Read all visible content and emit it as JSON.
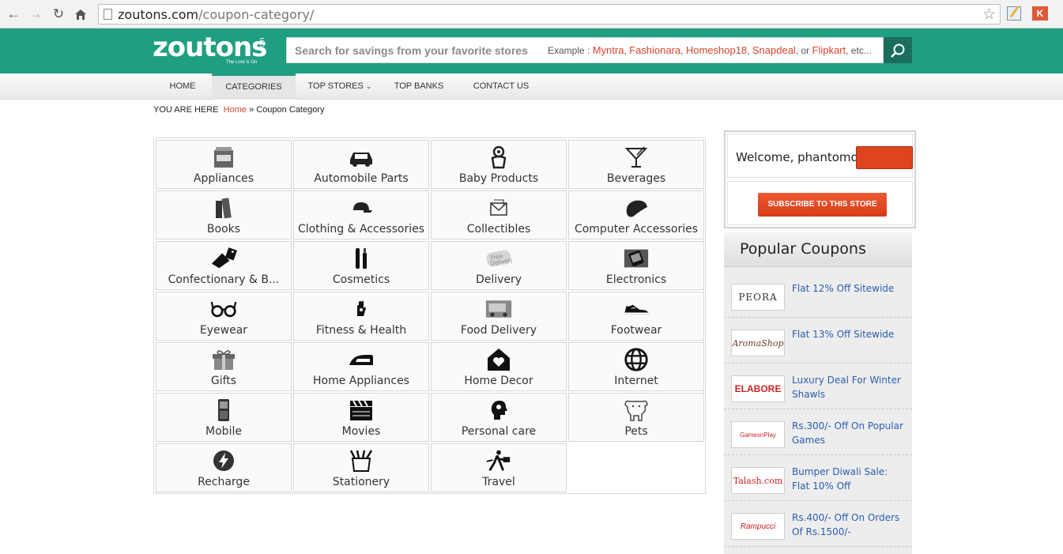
{
  "browser": {
    "url_domain": "zoutons.com",
    "url_path": "/coupon-category/",
    "ext2_label": "K"
  },
  "header": {
    "logo_word": "zoutons",
    "logo_com": ".com",
    "logo_tagline": "The Loot is On",
    "search_placeholder": "Search for savings from your favorite stores",
    "example_label": "Example :",
    "example_stores": [
      "Myntra",
      "Fashionara",
      "Homeshop18",
      "Snapdeal",
      "Flipkart"
    ],
    "example_sep": ",",
    "example_or": ", or",
    "example_etc": ", etc..."
  },
  "menu": {
    "items": [
      "HOME",
      "CATEGORIES",
      "TOP STORES",
      "TOP BANKS",
      "CONTACT US"
    ],
    "active": "CATEGORIES"
  },
  "breadcrumb": {
    "prefix": "YOU ARE HERE",
    "home": "Home",
    "sep": "»",
    "current": "Coupon Category"
  },
  "categories": [
    {
      "label": "Appliances",
      "icon": "appliance-icon"
    },
    {
      "label": "Automobile Parts",
      "icon": "car-icon"
    },
    {
      "label": "Baby Products",
      "icon": "baby-icon"
    },
    {
      "label": "Beverages",
      "icon": "cocktail-icon"
    },
    {
      "label": "Books",
      "icon": "books-icon"
    },
    {
      "label": "Clothing & Accessories",
      "icon": "cap-icon"
    },
    {
      "label": "Collectibles",
      "icon": "envelope-icon"
    },
    {
      "label": "Computer Accessories",
      "icon": "mouse-icon"
    },
    {
      "label": "Confectionary & B...",
      "icon": "candy-icon"
    },
    {
      "label": "Cosmetics",
      "icon": "cosmetics-icon"
    },
    {
      "label": "Delivery",
      "icon": "free-delivery-stamp-icon"
    },
    {
      "label": "Electronics",
      "icon": "phone-icon"
    },
    {
      "label": "Eyewear",
      "icon": "glasses-icon"
    },
    {
      "label": "Fitness & Health",
      "icon": "hand-icon"
    },
    {
      "label": "Food Delivery",
      "icon": "delivery-van-icon"
    },
    {
      "label": "Footwear",
      "icon": "shoe-icon"
    },
    {
      "label": "Gifts",
      "icon": "gift-icon"
    },
    {
      "label": "Home Appliances",
      "icon": "iron-icon"
    },
    {
      "label": "Home Decor",
      "icon": "house-heart-icon"
    },
    {
      "label": "Internet",
      "icon": "globe-icon"
    },
    {
      "label": "Mobile",
      "icon": "mobile-icon"
    },
    {
      "label": "Movies",
      "icon": "clapperboard-icon"
    },
    {
      "label": "Personal care",
      "icon": "head-icon"
    },
    {
      "label": "Pets",
      "icon": "dog-icon"
    },
    {
      "label": "Recharge",
      "icon": "lightning-icon"
    },
    {
      "label": "Stationery",
      "icon": "stationery-icon"
    },
    {
      "label": "Travel",
      "icon": "traveler-icon"
    }
  ],
  "sidebar": {
    "welcome": "Welcome, phantomdelight",
    "subscribe": "SUBSCRIBE TO THIS STORE",
    "popular_title": "Popular Coupons",
    "coupons": [
      {
        "store": "PEORA",
        "text": "Flat 12% Off Sitewide"
      },
      {
        "store": "AromaShop",
        "text": "Flat 13% Off Sitewide"
      },
      {
        "store": "ELABORE",
        "text": "Luxury Deal For Winter Shawls"
      },
      {
        "store": "GamesnPlay",
        "text": "Rs.300/- Off On Popular Games"
      },
      {
        "store": "Talash.com",
        "text": "Bumper Diwali Sale: Flat 10% Off"
      },
      {
        "store": "Rampucci",
        "text": "Rs.400/- Off On Orders Of Rs.1500/-"
      }
    ]
  },
  "colors": {
    "brand_green": "#1f9e82",
    "accent_orange": "#e0431f",
    "link_blue": "#2a5db0",
    "link_red": "#d9442c"
  }
}
